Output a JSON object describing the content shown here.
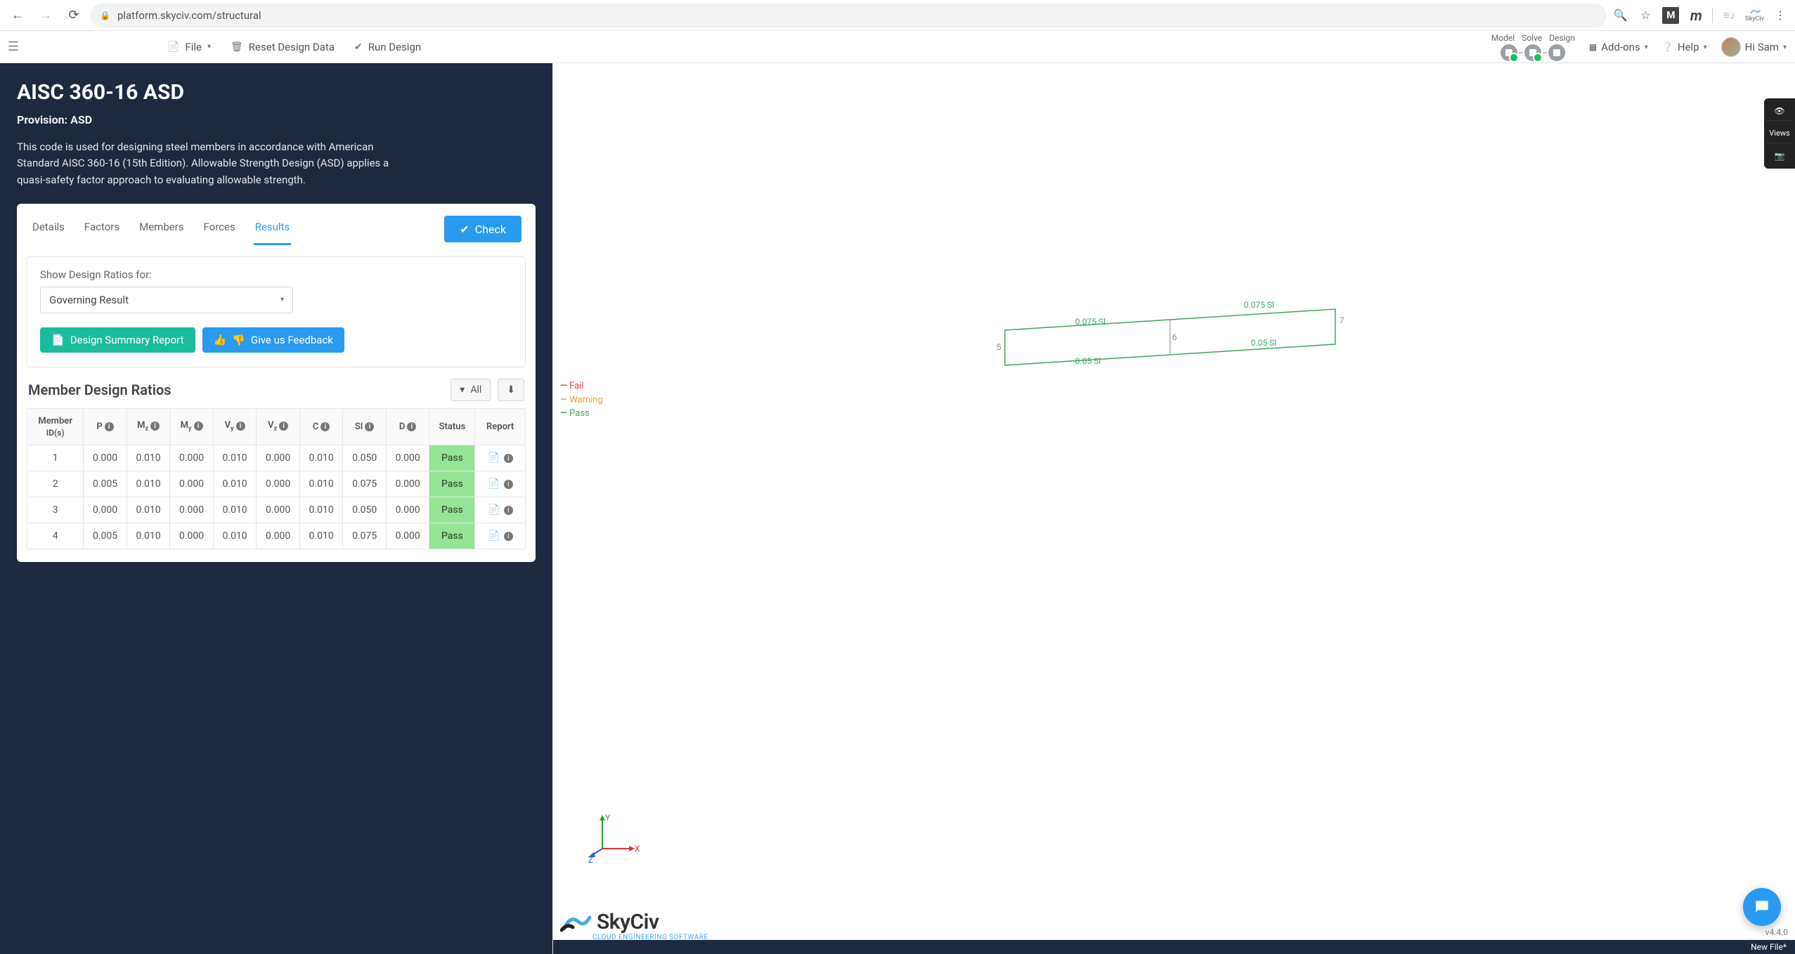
{
  "browser": {
    "url": "platform.skyciv.com/structural",
    "ext_m_label": "M",
    "ext_m2_label": "m",
    "skyciv_label": "SkyCiv"
  },
  "app_bar": {
    "file": "File",
    "reset": "Reset Design Data",
    "run": "Run Design",
    "steps_labels": [
      "Model",
      "Solve",
      "Design"
    ],
    "addons": "Add-ons",
    "help": "Help",
    "greeting": "Hi Sam"
  },
  "header": {
    "title": "AISC 360-16 ASD",
    "subtitle": "Provision: ASD",
    "description": "This code is used for designing steel members in accordance with American Standard AISC 360-16 (15th Edition). Allowable Strength Design (ASD) applies a quasi-safety factor approach to evaluating allowable strength."
  },
  "tabs": [
    "Details",
    "Factors",
    "Members",
    "Forces",
    "Results"
  ],
  "active_tab": "Results",
  "check_btn": "Check",
  "panel": {
    "label": "Show Design Ratios for:",
    "select_value": "Governing Result",
    "summary_btn": "Design Summary Report",
    "feedback_btn": "Give us Feedback"
  },
  "table": {
    "title": "Member Design Ratios",
    "filter_btn": "All",
    "headers": {
      "member": "Member",
      "member_sub": "ID(s)",
      "p": "P",
      "mz": "M",
      "my": "M",
      "vy": "V",
      "vz": "V",
      "c": "C",
      "sl": "Sl",
      "d": "D",
      "status": "Status",
      "report": "Report"
    },
    "rows": [
      {
        "id": "1",
        "p": "0.000",
        "mz": "0.010",
        "my": "0.000",
        "vy": "0.010",
        "vz": "0.000",
        "c": "0.010",
        "sl": "0.050",
        "d": "0.000",
        "status": "Pass"
      },
      {
        "id": "2",
        "p": "0.005",
        "mz": "0.010",
        "my": "0.000",
        "vy": "0.010",
        "vz": "0.000",
        "c": "0.010",
        "sl": "0.075",
        "d": "0.000",
        "status": "Pass"
      },
      {
        "id": "3",
        "p": "0.000",
        "mz": "0.010",
        "my": "0.000",
        "vy": "0.010",
        "vz": "0.000",
        "c": "0.010",
        "sl": "0.050",
        "d": "0.000",
        "status": "Pass"
      },
      {
        "id": "4",
        "p": "0.005",
        "mz": "0.010",
        "my": "0.000",
        "vy": "0.010",
        "vz": "0.000",
        "c": "0.010",
        "sl": "0.075",
        "d": "0.000",
        "status": "Pass"
      }
    ]
  },
  "right": {
    "views_label": "Views",
    "legend": {
      "fail": "Fail",
      "warn": "Warning",
      "pass": "Pass"
    },
    "model_labels": [
      "0.075 Sl",
      "0.05 Sl",
      "0.075 Sl",
      "0.05 Sl"
    ],
    "model_nodes": [
      "5",
      "6",
      "7"
    ],
    "axes": {
      "x": "X",
      "y": "Y",
      "z": "Z"
    },
    "logo": "SkyCiv",
    "logo_sub": "CLOUD ENGINEERING SOFTWARE",
    "version": "v4.4.0",
    "status_file": "New File*"
  }
}
